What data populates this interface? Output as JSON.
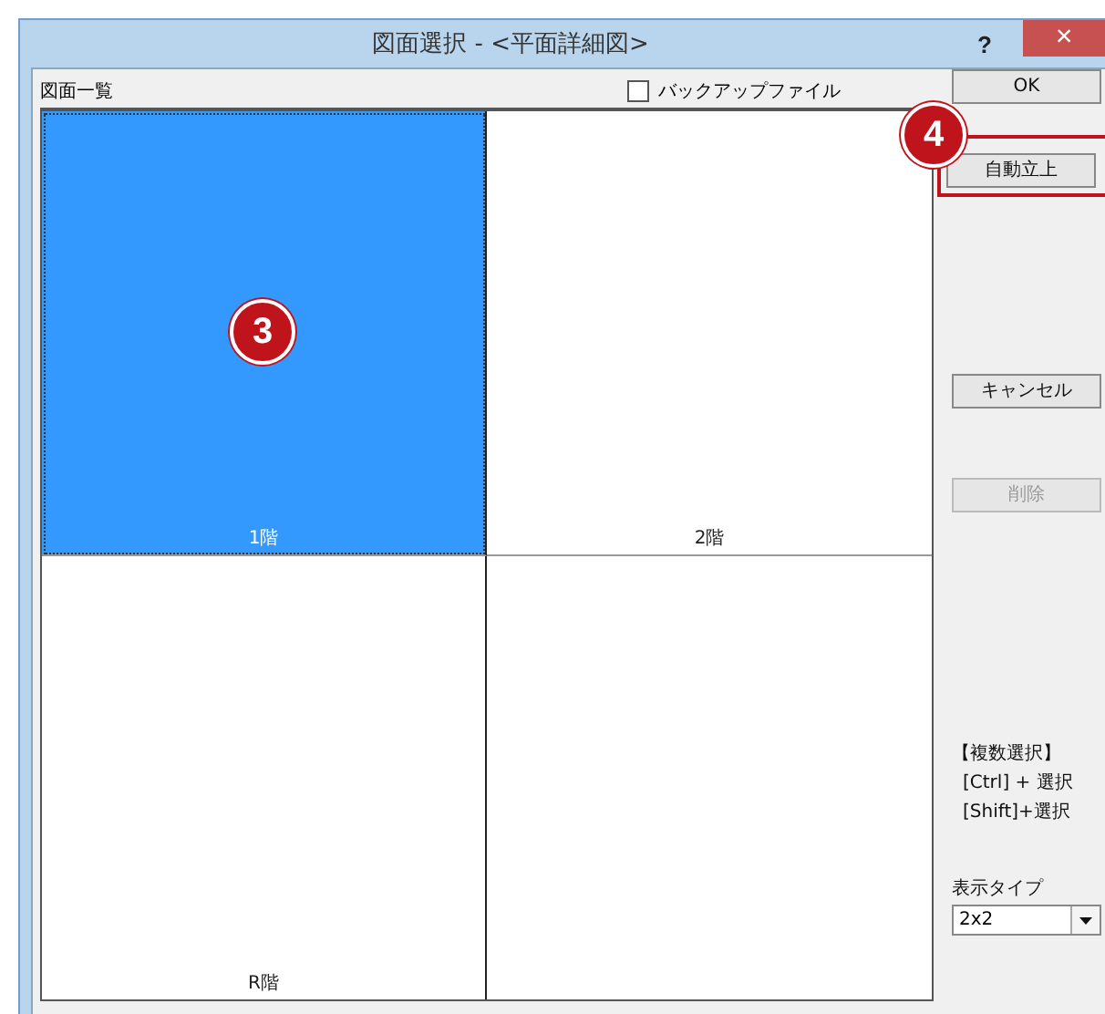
{
  "window": {
    "title": "図面選択 - <平面詳細図>",
    "help": "?",
    "close": "×"
  },
  "list": {
    "label": "図面一覧",
    "backup": {
      "label": "バックアップファイル",
      "checked": false
    },
    "cells": [
      {
        "name": "1階",
        "selected": true,
        "callout": "3"
      },
      {
        "name": "2階",
        "selected": false
      },
      {
        "name": "R階",
        "selected": false
      },
      {
        "selected": false
      }
    ]
  },
  "buttons": [
    {
      "label": "OK",
      "disabled": false
    },
    {
      "label": "自動立上",
      "disabled": false,
      "callout": "4"
    },
    {
      "label": "キャンセル",
      "disabled": false
    },
    {
      "label": "削除",
      "disabled": true
    }
  ],
  "hint": [
    "【複数選択】",
    "[Ctrl] + 選択",
    "[Shift]+選択"
  ],
  "display_type": {
    "label": "表示タイプ",
    "value": "2x2"
  }
}
